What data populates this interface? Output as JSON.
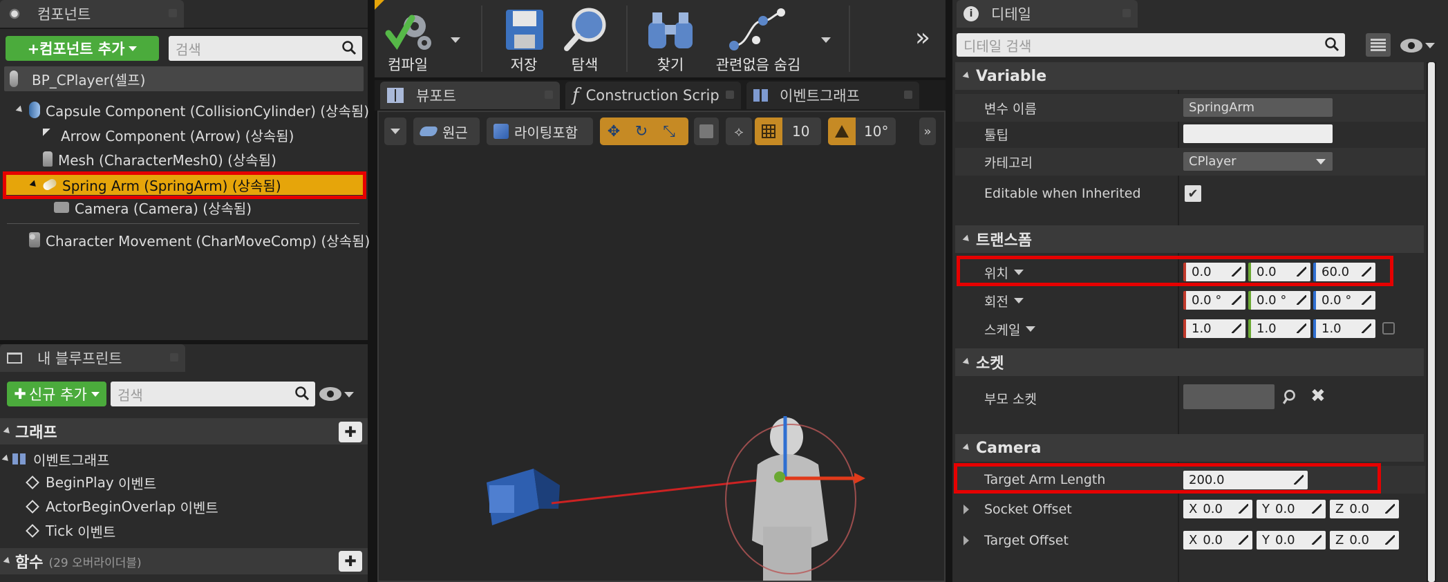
{
  "components_panel": {
    "tab_title": "컴포넌트",
    "add_button": "+컴포넌트 추가",
    "search_placeholder": "검색",
    "self_item": "BP_CPlayer(셀프)",
    "tree": [
      {
        "label": "Capsule Component (CollisionCylinder) (상속됨)",
        "icon": "capsule-icon"
      },
      {
        "label": "Arrow Component (Arrow) (상속됨)",
        "icon": "arrow-component-icon"
      },
      {
        "label": "Mesh (CharacterMesh0) (상속됨)",
        "icon": "mesh-icon"
      },
      {
        "label": "Spring Arm (SpringArm) (상속됨)",
        "icon": "spring-arm-icon"
      },
      {
        "label": "Camera (Camera) (상속됨)",
        "icon": "camera-icon"
      },
      {
        "label": "Character Movement (CharMoveComp) (상속됨)",
        "icon": "movement-icon"
      }
    ]
  },
  "my_blueprint": {
    "tab_title": "내 블루프린트",
    "add_button": "신규 추가",
    "search_placeholder": "검색",
    "graph_section": "그래프",
    "event_graph": "이벤트그래프",
    "events": [
      {
        "name": "BeginPlay",
        "suffix": "이벤트"
      },
      {
        "name": "ActorBeginOverlap",
        "suffix": "이벤트"
      },
      {
        "name": "Tick",
        "suffix": "이벤트"
      }
    ],
    "functions_section": "함수",
    "functions_override": "(29 오버라이더블)"
  },
  "toolbar": {
    "compile": "컴파일",
    "save": "저장",
    "browse": "탐색",
    "find": "찾기",
    "hide_unrelated": "관련없음 숨김"
  },
  "viewport": {
    "tabs": [
      "뷰포트",
      "Construction Scrip",
      "이벤트그래프"
    ],
    "perspective": "원근",
    "lit": "라이팅포함",
    "grid_snap": "10",
    "angle_snap": "10°"
  },
  "details": {
    "tab_title": "디테일",
    "search_placeholder": "디테일 검색",
    "variable_section": "Variable",
    "var_name_label": "변수 이름",
    "var_name_value": "SpringArm",
    "tooltip_label": "툴팁",
    "tooltip_value": "",
    "category_label": "카테고리",
    "category_value": "CPlayer",
    "editable_label": "Editable when Inherited",
    "editable_checked": true,
    "transform_section": "트랜스폼",
    "location_label": "위치",
    "location": [
      "0.0",
      "0.0",
      "60.0"
    ],
    "rotation_label": "회전",
    "rotation": [
      "0.0 °",
      "0.0 °",
      "0.0 °"
    ],
    "scale_label": "스케일",
    "scale": [
      "1.0",
      "1.0",
      "1.0"
    ],
    "socket_section": "소켓",
    "parent_socket_label": "부모 소켓",
    "camera_section": "Camera",
    "target_arm_length_label": "Target Arm Length",
    "target_arm_length_value": "200.0",
    "socket_offset_label": "Socket Offset",
    "socket_offset": [
      "0.0",
      "0.0",
      "0.0"
    ],
    "target_offset_label": "Target Offset",
    "target_offset": [
      "0.0",
      "0.0",
      "0.0"
    ],
    "axis_letters": [
      "X",
      "Y",
      "Z"
    ]
  },
  "colors": {
    "highlight": "#e6a50a",
    "annotation_red": "#e60000",
    "green_button": "#4bab3c",
    "axis_x": "#c0392b",
    "axis_y": "#6aa832",
    "axis_z": "#2f6fd1"
  }
}
